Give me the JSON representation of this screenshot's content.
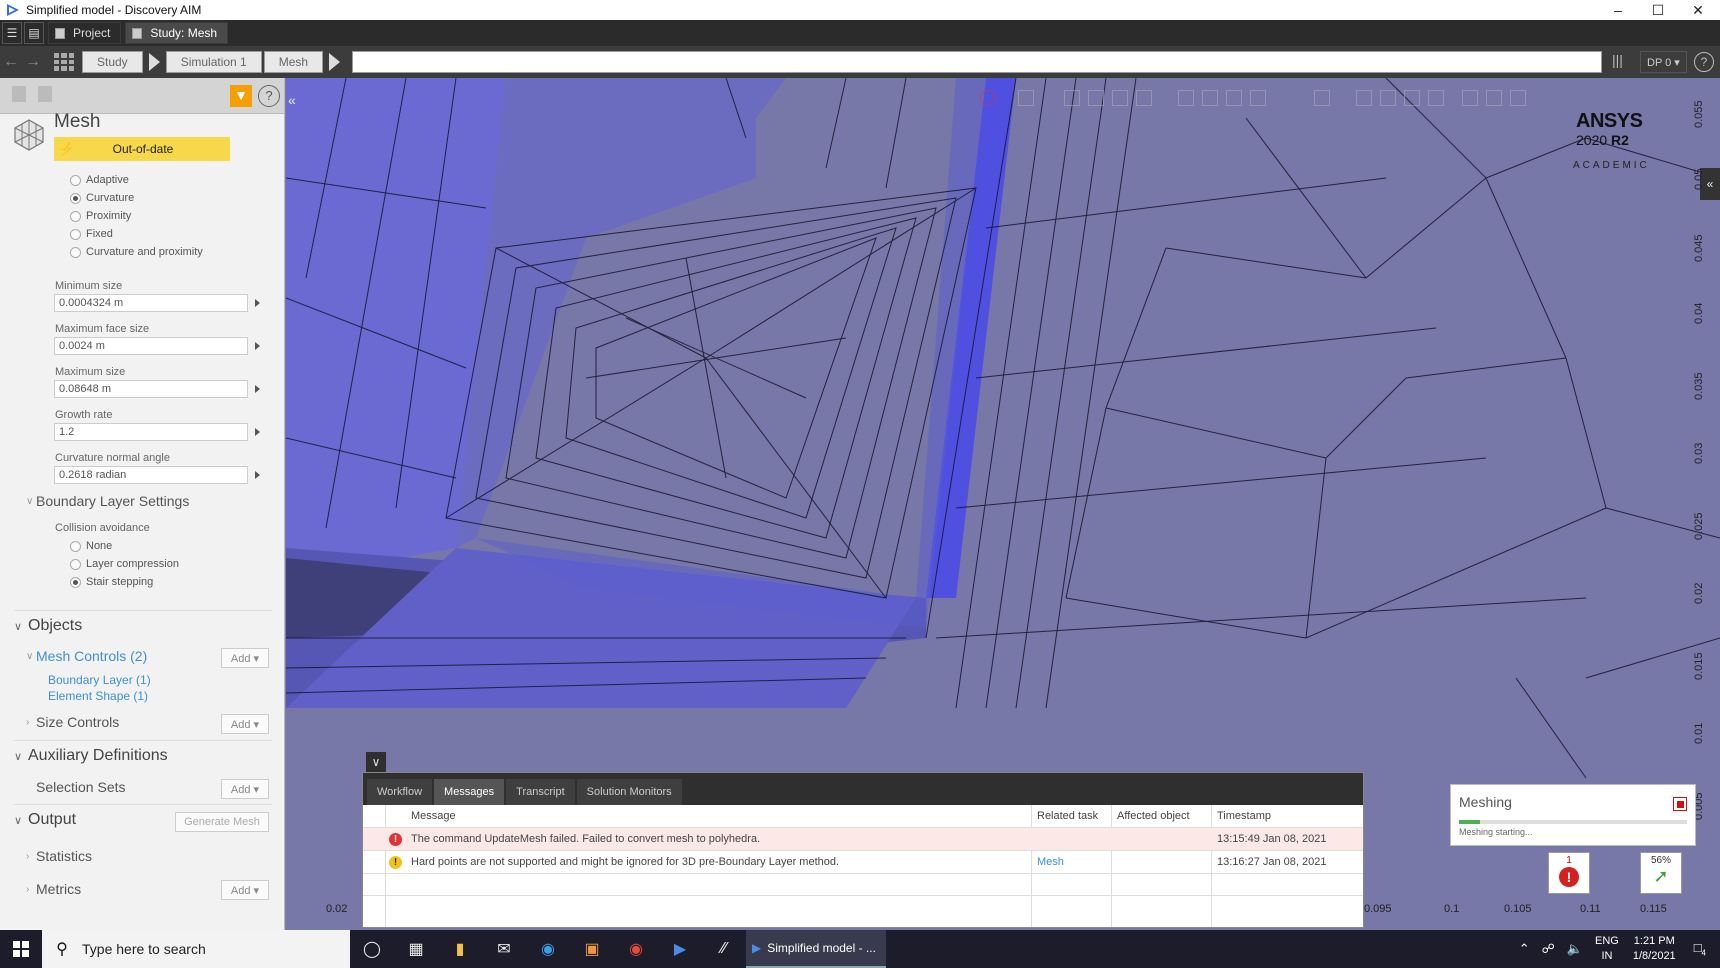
{
  "window": {
    "title": "Simplified model - Discovery AIM"
  },
  "menubar": {
    "tabs": [
      {
        "label": "Project"
      },
      {
        "label": "Study: Mesh"
      }
    ]
  },
  "breadcrumb": {
    "items": [
      "Study",
      "Simulation 1",
      "Mesh"
    ],
    "dp": "DP 0 ▾"
  },
  "panel": {
    "title": "Mesh",
    "status": "Out-of-date",
    "sizing_options": [
      {
        "label": "Adaptive",
        "checked": false
      },
      {
        "label": "Curvature",
        "checked": true
      },
      {
        "label": "Proximity",
        "checked": false
      },
      {
        "label": "Fixed",
        "checked": false
      },
      {
        "label": "Curvature and proximity",
        "checked": false
      }
    ],
    "fields": [
      {
        "label": "Minimum size",
        "value": "0.0004324 m"
      },
      {
        "label": "Maximum face size",
        "value": "0.0024 m"
      },
      {
        "label": "Maximum size",
        "value": "0.08648 m"
      },
      {
        "label": "Growth rate",
        "value": "1.2"
      },
      {
        "label": "Curvature normal angle",
        "value": "0.2618 radian"
      }
    ],
    "boundary_layer": {
      "heading": "Boundary Layer Settings",
      "collision_label": "Collision avoidance",
      "options": [
        {
          "label": "None",
          "checked": false
        },
        {
          "label": "Layer compression",
          "checked": false
        },
        {
          "label": "Stair stepping",
          "checked": true
        }
      ]
    },
    "objects": {
      "heading": "Objects",
      "mesh_controls": "Mesh Controls (2)",
      "children": [
        "Boundary Layer (1)",
        "Element Shape (1)"
      ],
      "size_controls": "Size Controls",
      "add_label": "Add ▾"
    },
    "auxiliary": {
      "heading": "Auxiliary Definitions",
      "selection_sets": "Selection Sets"
    },
    "output": {
      "heading": "Output",
      "generate": "Generate Mesh",
      "statistics": "Statistics",
      "metrics": "Metrics"
    }
  },
  "viewport": {
    "logo": {
      "brand": "ANSYS",
      "version": "2020",
      "release": "R2",
      "edition": "ACADEMIC"
    },
    "y_ticks": [
      "0.055",
      "0.05",
      "0.045",
      "0.04",
      "0.035",
      "0.03",
      "0.025",
      "0.02",
      "0.015",
      "0.01",
      "0.005"
    ],
    "x_ticks": [
      "0.02",
      "0.095",
      "0.1",
      "0.105",
      "0.11",
      "0.115"
    ]
  },
  "messages": {
    "tabs": [
      "Workflow",
      "Messages",
      "Transcript",
      "Solution Monitors"
    ],
    "active_tab": "Messages",
    "columns": [
      "Message",
      "Related task",
      "Affected object",
      "Timestamp"
    ],
    "rows": [
      {
        "level": "error",
        "message": "The command UpdateMesh failed. Failed to convert mesh to polyhedra.",
        "task": "",
        "object": "",
        "timestamp": "13:15:49 Jan 08, 2021"
      },
      {
        "level": "warning",
        "message": "Hard points are not supported and might be ignored for 3D pre-Boundary Layer method.",
        "task": "Mesh",
        "object": "",
        "timestamp": "13:16:27 Jan 08, 2021"
      }
    ]
  },
  "meshing_status": {
    "title": "Meshing",
    "status": "Meshing starting...",
    "progress": 0.09
  },
  "notifications": {
    "errors": "1",
    "progress": "56%"
  },
  "taskbar": {
    "search_placeholder": "Type here to search",
    "active_app": "Simplified model - ...",
    "lang": "ENG",
    "region": "IN",
    "time": "1:21 PM",
    "date": "1/8/2021",
    "notif_count": "4"
  }
}
